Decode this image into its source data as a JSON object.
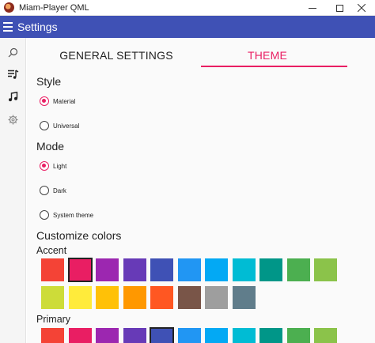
{
  "window": {
    "title": "Miam-Player QML"
  },
  "appbar": {
    "title": "Settings"
  },
  "rail": {
    "items": [
      "search-icon",
      "playlist-icon",
      "music-note-icon",
      "gear-icon"
    ]
  },
  "tabs": [
    {
      "label": "GENERAL SETTINGS",
      "selected": false
    },
    {
      "label": "THEME",
      "selected": true
    }
  ],
  "style": {
    "heading": "Style",
    "options": [
      {
        "label": "Material",
        "checked": true
      },
      {
        "label": "Universal",
        "checked": false
      }
    ]
  },
  "mode": {
    "heading": "Mode",
    "options": [
      {
        "label": "Light",
        "checked": true
      },
      {
        "label": "Dark",
        "checked": false
      },
      {
        "label": "System theme",
        "checked": false
      }
    ]
  },
  "colors": {
    "heading": "Customize colors",
    "accent": {
      "label": "Accent",
      "selected_index": 1,
      "swatches": [
        "#f44336",
        "#e91e63",
        "#9c27b0",
        "#673ab7",
        "#3f51b5",
        "#2196f3",
        "#03a9f4",
        "#00bcd4",
        "#009688",
        "#4caf50",
        "#8bc34a",
        "#cddc39",
        "#ffeb3b",
        "#ffc107",
        "#ff9800",
        "#ff5722",
        "#795548",
        "#9e9e9e",
        "#607d8b"
      ]
    },
    "primary": {
      "label": "Primary",
      "selected_index": 4,
      "swatches": [
        "#f44336",
        "#e91e63",
        "#9c27b0",
        "#673ab7",
        "#3f51b5",
        "#2196f3",
        "#03a9f4",
        "#00bcd4",
        "#009688",
        "#4caf50",
        "#8bc34a"
      ]
    }
  },
  "theme_colors": {
    "accent": "#e91e63",
    "appbar": "#3f51b5"
  }
}
